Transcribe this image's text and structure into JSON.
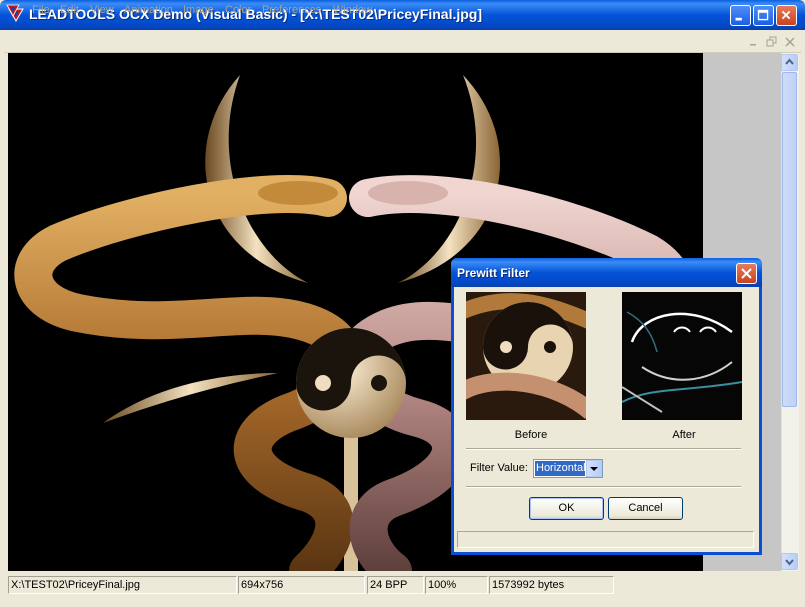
{
  "window": {
    "title": "LEADTOOLS OCX Demo (Visual Basic) - [X:\\TEST02\\PriceyFinal.jpg]",
    "icon": "leadtools-logo-icon",
    "accent": "#0454d8"
  },
  "menu": {
    "items": [
      "File",
      "Edit",
      "View",
      "Animation",
      "Image",
      "Color",
      "Preferences",
      "Window"
    ],
    "disabled_color": "#a6a496"
  },
  "image": {
    "description_icon": "caduceus-snakes-yin-yang-image"
  },
  "status": {
    "file": "X:\\TEST02\\PriceyFinal.jpg",
    "dimensions": "694x756",
    "bpp": "24 BPP",
    "zoom": "100%",
    "size": "1573992 bytes"
  },
  "dialog": {
    "title": "Prewitt Filter",
    "before_label": "Before",
    "after_label": "After",
    "filter_label": "Filter Value:",
    "filter_value": "Horizontal",
    "ok_label": "OK",
    "cancel_label": "Cancel",
    "progress": 0
  }
}
